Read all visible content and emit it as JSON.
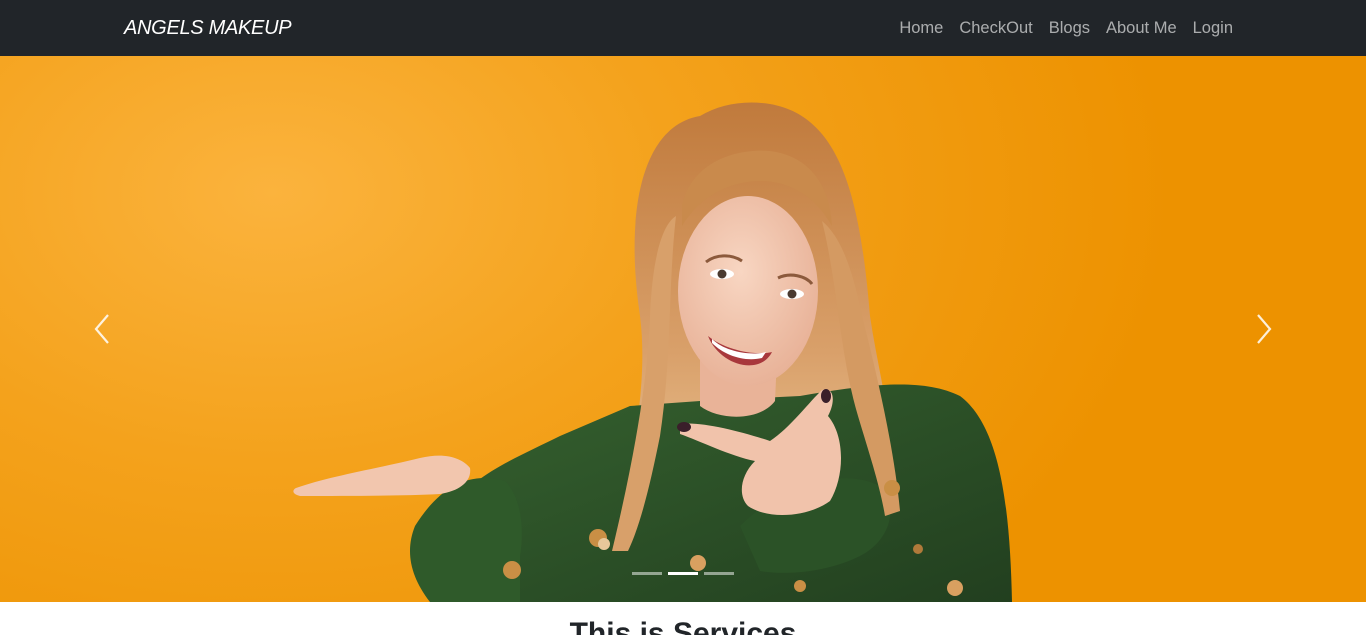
{
  "navbar": {
    "brand": "ANGELS MAKEUP",
    "links": [
      "Home",
      "CheckOut",
      "Blogs",
      "About Me",
      "Login"
    ]
  },
  "carousel": {
    "slide_image": "smiling woman in green sweater pointing to her open palm on orange background",
    "prev_icon": "chevron-left-icon",
    "next_icon": "chevron-right-icon",
    "indicator_count": 3,
    "active_indicator": 2
  },
  "services": {
    "title": "This is Services"
  },
  "colors": {
    "navbar_bg": "#212529",
    "hero_orange": "#f4a21c",
    "sweater_green": "#2d5128"
  }
}
